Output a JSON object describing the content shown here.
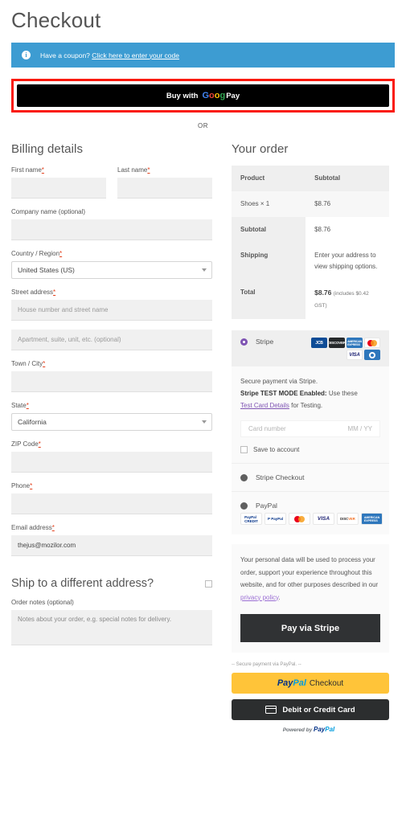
{
  "page": {
    "title": "Checkout"
  },
  "coupon": {
    "icon": "info-icon",
    "text": "Have a coupon?",
    "link_text": "Click here to enter your code",
    "bg_color": "#3d9cd2"
  },
  "express": {
    "gpay_label": "Buy with",
    "gpay_brand": "Pay",
    "gpay_logo": "google-g-icon",
    "or_divider": "OR",
    "highlight_color": "#fa1a0e"
  },
  "billing": {
    "heading": "Billing details",
    "fields": [
      {
        "label": "First name",
        "required": true,
        "value": "",
        "placeholder": ""
      },
      {
        "label": "Last name",
        "required": true,
        "value": "",
        "placeholder": ""
      },
      {
        "label": "Company name (optional)",
        "required": false,
        "value": "",
        "placeholder": ""
      },
      {
        "label": "Country / Region",
        "required": true,
        "value": "United States (US)",
        "type": "select"
      },
      {
        "label": "Street address",
        "required": true,
        "value": "",
        "placeholder": "House number and street name"
      },
      {
        "label": "",
        "required": false,
        "value": "",
        "placeholder": "Apartment, suite, unit, etc. (optional)"
      },
      {
        "label": "Town / City",
        "required": true,
        "value": "",
        "placeholder": ""
      },
      {
        "label": "State",
        "required": true,
        "value": "California",
        "type": "select"
      },
      {
        "label": "ZIP Code",
        "required": true,
        "value": "",
        "placeholder": ""
      },
      {
        "label": "Phone",
        "required": true,
        "value": "",
        "placeholder": ""
      },
      {
        "label": "Email address",
        "required": true,
        "value": "thejus@mozilor.com",
        "placeholder": ""
      }
    ],
    "ship_different_label": "Ship to a different address?",
    "ship_different_checked": false,
    "order_notes_label": "Order notes (optional)",
    "order_notes_placeholder": "Notes about your order, e.g. special notes for delivery."
  },
  "order": {
    "heading": "Your order",
    "columns": [
      "Product",
      "Subtotal"
    ],
    "items": [
      {
        "name": "Shoes  × 1",
        "subtotal": "$8.76"
      }
    ],
    "rows": [
      {
        "label": "Subtotal",
        "value": "$8.76"
      },
      {
        "label": "Shipping",
        "value": "Enter your address to view shipping options."
      }
    ],
    "total": {
      "label": "Total",
      "amount": "$8.76",
      "note": "(includes $0.42 GST)"
    }
  },
  "payment": {
    "stripe": {
      "name": "Stripe",
      "selected": true,
      "accent_color": "#7f54b3",
      "cards": [
        "JCB",
        "DISCOVER",
        "AMERICAN EXPRESS",
        "mastercard",
        "VISA",
        "Diners Club"
      ],
      "desc_line1": "Secure payment via Stripe.",
      "desc_bold": "Stripe TEST MODE Enabled:",
      "desc_line2": "Use these",
      "test_link": "Test Card Details",
      "desc_line3": "for Testing.",
      "card_placeholder": "Card number",
      "expiry_placeholder": "MM / YY",
      "save_label": "Save to account",
      "save_checked": false
    },
    "options": [
      {
        "name": "Stripe Checkout",
        "selected": false
      },
      {
        "name": "PayPal",
        "selected": false,
        "cards": [
          "PayPal CREDIT",
          "P PayPal",
          "mastercard",
          "VISA",
          "DISCOVER",
          "AMEX"
        ]
      }
    ]
  },
  "privacy": {
    "text_before": "Your personal data will be used to process your order, support your experience throughout this website, and for other purposes described in our",
    "link": "privacy policy",
    "text_after": ".",
    "submit_label": "Pay via Stripe"
  },
  "paypal": {
    "secure_note": "-- Secure payment via PayPal. --",
    "checkout_brand_pay": "Pay",
    "checkout_brand_pal": "Pal",
    "checkout_label": "Checkout",
    "debit_label": "Debit or Credit Card",
    "powered_prefix": "Powered by",
    "powered_pay": "Pay",
    "powered_pal": "Pal",
    "button_color": "#ffc439"
  }
}
